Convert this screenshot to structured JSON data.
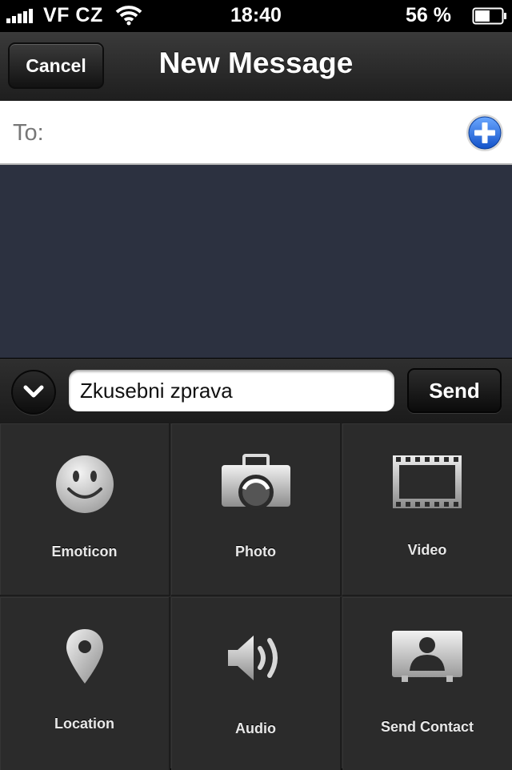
{
  "status_bar": {
    "carrier": "VF CZ",
    "time": "18:40",
    "battery_percent": "56 %",
    "battery_level": 0.56
  },
  "nav": {
    "cancel_label": "Cancel",
    "title": "New Message"
  },
  "recipients": {
    "to_label": "To:",
    "value": ""
  },
  "compose": {
    "message_value": "Zkusebni zprava",
    "send_label": "Send"
  },
  "attachments": {
    "items": [
      {
        "label": "Emoticon",
        "icon": "smiley-icon"
      },
      {
        "label": "Photo",
        "icon": "camera-icon"
      },
      {
        "label": "Video",
        "icon": "film-icon"
      },
      {
        "label": "Location",
        "icon": "map-pin-icon"
      },
      {
        "label": "Audio",
        "icon": "speaker-icon"
      },
      {
        "label": "Send Contact",
        "icon": "contact-card-icon"
      }
    ]
  },
  "colors": {
    "accent_blue": "#1f6fe8",
    "thread_bg": "#2c3140",
    "grid_bg": "#2b2b2b"
  }
}
